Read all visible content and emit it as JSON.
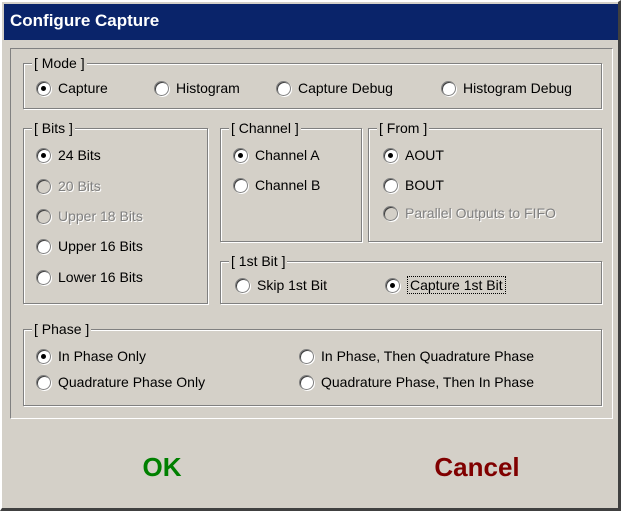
{
  "title": "Configure Capture",
  "mode": {
    "legend": "[ Mode ]",
    "options": [
      "Capture",
      "Histogram",
      "Capture Debug",
      "Histogram Debug"
    ],
    "selected": "Capture"
  },
  "bits": {
    "legend": "[ Bits ]",
    "options": [
      "24 Bits",
      "20 Bits",
      "Upper 18 Bits",
      "Upper 16 Bits",
      "Lower 16 Bits"
    ],
    "disabled": [
      "20 Bits",
      "Upper 18 Bits"
    ],
    "selected": "24 Bits"
  },
  "channel": {
    "legend": "[ Channel ]",
    "options": [
      "Channel A",
      "Channel B"
    ],
    "selected": "Channel A"
  },
  "from": {
    "legend": "[ From ]",
    "options": [
      "AOUT",
      "BOUT",
      "Parallel Outputs to FIFO"
    ],
    "disabled": [
      "Parallel Outputs to FIFO"
    ],
    "selected": "AOUT"
  },
  "first_bit": {
    "legend": "[ 1st Bit ]",
    "options": [
      "Skip 1st Bit",
      "Capture 1st Bit"
    ],
    "selected": "Capture 1st Bit"
  },
  "phase": {
    "legend": "[ Phase ]",
    "options": [
      "In Phase Only",
      "Quadrature Phase Only",
      "In Phase, Then Quadrature Phase",
      "Quadrature Phase, Then In Phase"
    ],
    "selected": "In Phase Only"
  },
  "buttons": {
    "ok": "OK",
    "cancel": "Cancel"
  },
  "colors": {
    "title_bg": "#0a246a",
    "ok": "#008000",
    "cancel": "#800000",
    "face": "#d4d0c8"
  }
}
